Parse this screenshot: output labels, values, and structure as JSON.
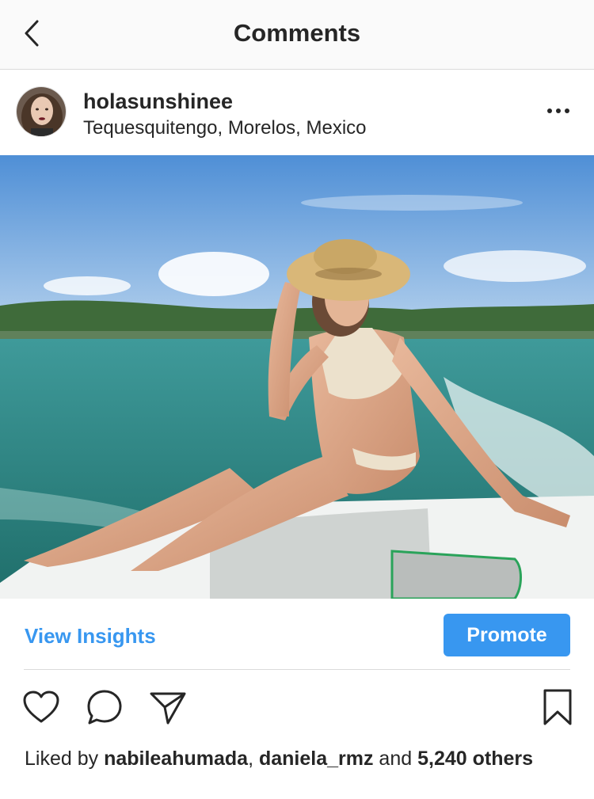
{
  "nav": {
    "title": "Comments",
    "back_icon": "chevron-left-icon"
  },
  "post": {
    "username": "holasunshinee",
    "location": "Tequesquitengo, Morelos, Mexico",
    "more_icon": "ellipsis-icon"
  },
  "insights": {
    "view_label": "View Insights",
    "promote_label": "Promote"
  },
  "actions": {
    "like_icon": "heart-icon",
    "comment_icon": "comment-icon",
    "share_icon": "send-icon",
    "save_icon": "bookmark-icon"
  },
  "likes": {
    "prefix": "Liked by ",
    "user1": "nabileahumada",
    "sep": ", ",
    "user2": "daniela_rmz",
    "and": " and ",
    "count": "5,240 others"
  },
  "colors": {
    "accent": "#3897f0",
    "text": "#262626",
    "divider": "#dbdbdb",
    "nav_bg": "#fafafa"
  }
}
